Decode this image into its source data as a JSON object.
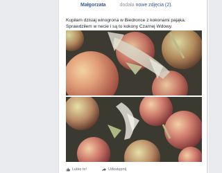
{
  "post": {
    "author": "Małgorzata",
    "added_text": "dodała",
    "photos_link": "nowe zdjęcia (2).",
    "body": "Kupiłam dzisiaj winogrona w Biedronce z kokonami pająka. Sprawdziłem w necie i są to kokony Czarnej Wdowy."
  },
  "actions": {
    "like": "Lubię to!",
    "share": "Udostępnij"
  },
  "icons": {
    "like": "thumbs-up-icon",
    "share": "share-arrow-icon"
  },
  "colors": {
    "link": "#365899",
    "background": "#e9ebee"
  }
}
